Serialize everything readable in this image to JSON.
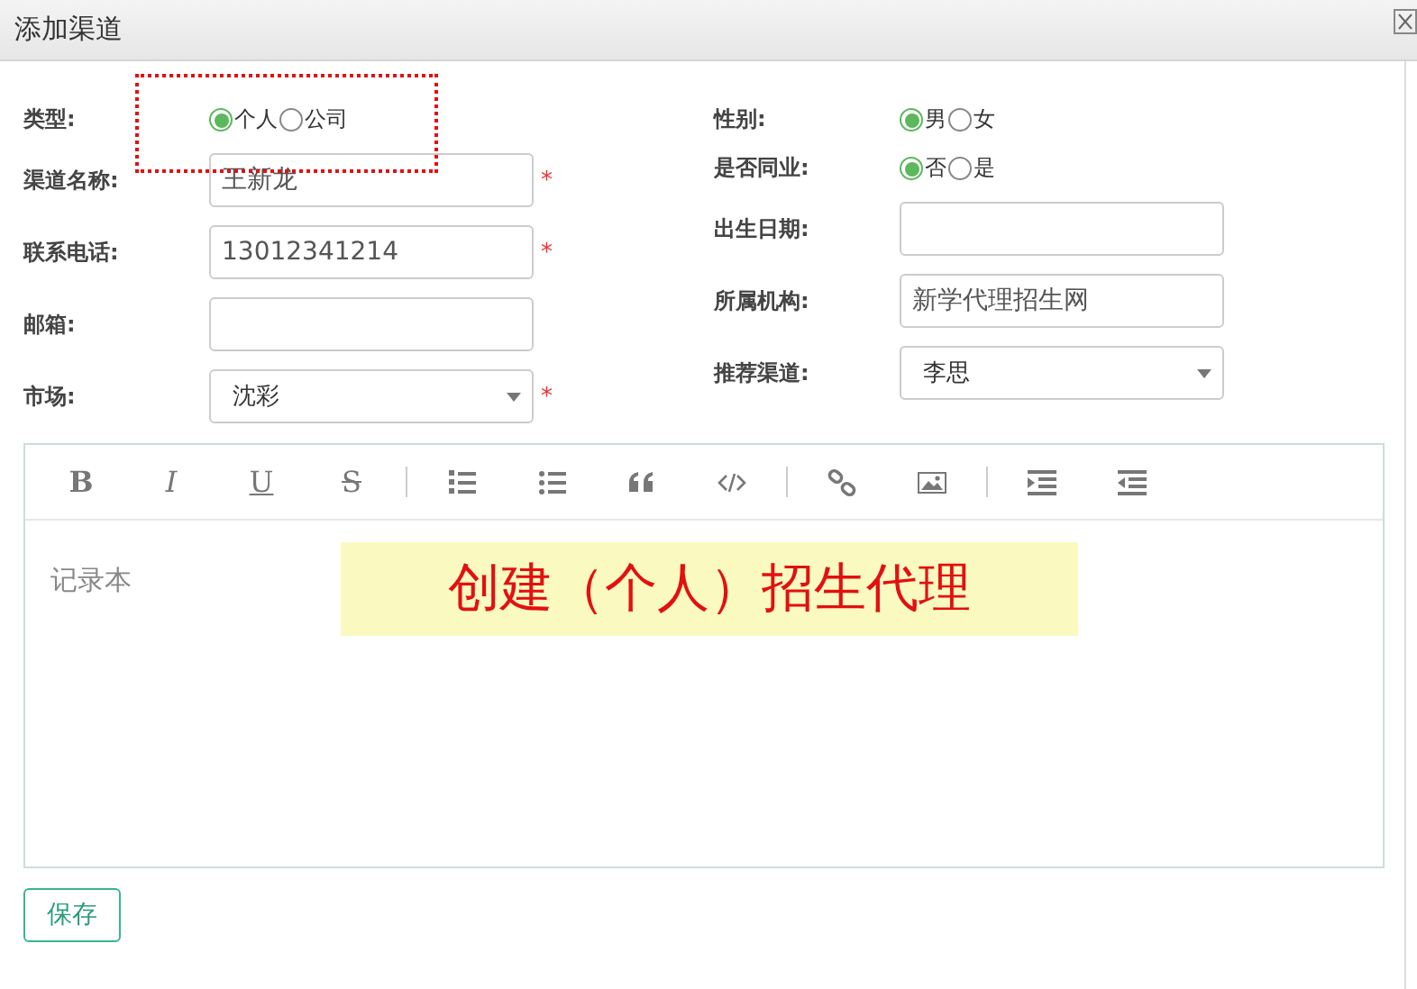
{
  "window": {
    "title": "添加渠道"
  },
  "left_fields": [
    {
      "kind": "radio",
      "label": "类型:",
      "options": [
        {
          "label": "个人",
          "selected": true
        },
        {
          "label": "公司",
          "selected": false
        }
      ]
    },
    {
      "kind": "text",
      "label": "渠道名称:",
      "value": "王新龙",
      "mark": "*"
    },
    {
      "kind": "text",
      "label": "联系电话:",
      "value": "13012341214",
      "mark": "*"
    },
    {
      "kind": "text",
      "label": "邮箱:"
    },
    {
      "kind": "select",
      "label": "市场:",
      "value": "沈彩",
      "mark": "*"
    }
  ],
  "right_fields": [
    {
      "kind": "radio",
      "label": "性别:",
      "options": [
        {
          "label": "男",
          "selected": true
        },
        {
          "label": "女",
          "selected": false
        }
      ]
    },
    {
      "kind": "radio",
      "label": "是否同业:",
      "options": [
        {
          "label": "否",
          "selected": true
        },
        {
          "label": "是",
          "selected": false
        }
      ]
    },
    {
      "kind": "text",
      "label": "出生日期:"
    },
    {
      "kind": "text",
      "label": "所属机构:",
      "value": "新学代理招生网"
    },
    {
      "kind": "select",
      "label": "推荐渠道:",
      "value": "李思"
    }
  ],
  "editor": {
    "toolbar": [
      [
        {
          "kind": "bold",
          "label": "B"
        },
        {
          "kind": "italic",
          "label": "I"
        },
        {
          "kind": "underline",
          "label": "U"
        },
        {
          "kind": "strike",
          "label": "S"
        }
      ],
      [
        {
          "kind": "ordered-list"
        },
        {
          "kind": "bullet-list"
        },
        {
          "kind": "quote"
        },
        {
          "kind": "code"
        }
      ],
      [
        {
          "kind": "link"
        },
        {
          "kind": "image"
        }
      ],
      [
        {
          "kind": "indent"
        },
        {
          "kind": "outdent"
        }
      ]
    ],
    "placeholder": "记录本"
  },
  "annotation": {
    "text": "创建（个人）招生代理"
  },
  "buttons": [
    {
      "label": "保存"
    }
  ]
}
